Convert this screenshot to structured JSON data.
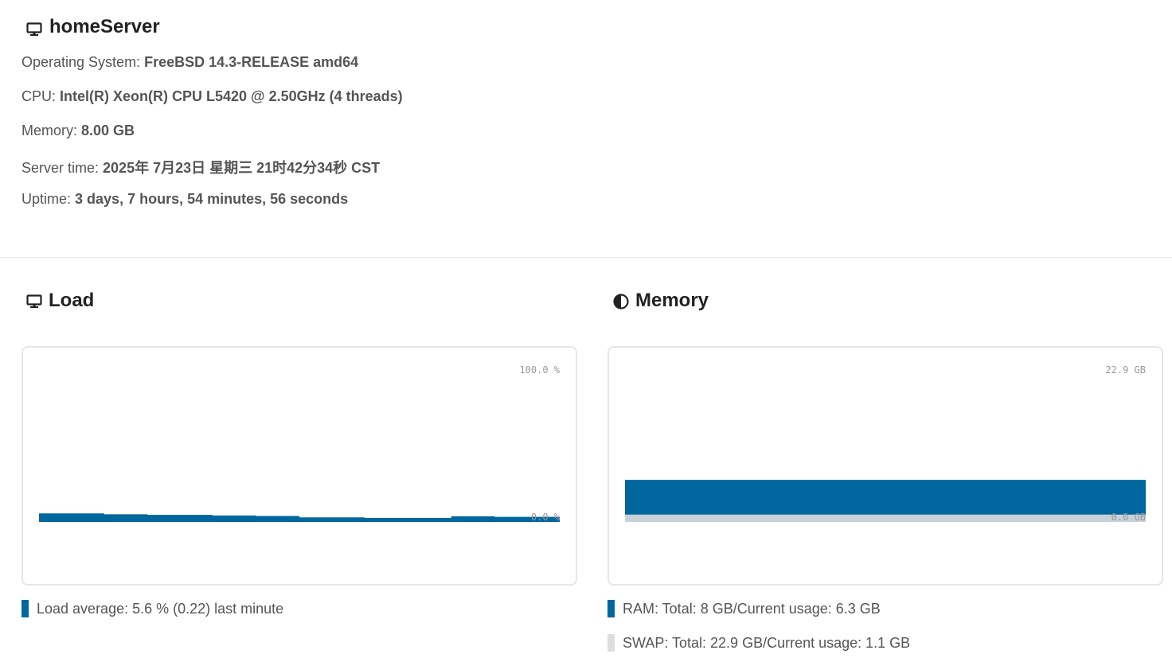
{
  "host": {
    "name": "homeServer",
    "icon": "monitor-icon"
  },
  "info": {
    "os_label": "Operating System: ",
    "os_value": "FreeBSD 14.3-RELEASE amd64",
    "cpu_label": "CPU: ",
    "cpu_value": "Intel(R) Xeon(R) CPU L5420 @ 2.50GHz (4 threads)",
    "memory_label": "Memory: ",
    "memory_value": "8.00 GB",
    "time_label": "Server time: ",
    "time_value": "2025年 7月23日 星期三 21时42分34秒 CST",
    "uptime_label": "Uptime: ",
    "uptime_value": "3 days, 7 hours, 54 minutes, 56 seconds"
  },
  "load": {
    "title": "Load",
    "icon": "monitor-icon",
    "legend": "Load average: 5.6 % (0.22) last minute",
    "color": "#00669e"
  },
  "memory": {
    "title": "Memory",
    "icon": "half-circle-icon",
    "legend_ram": "RAM: Total: 8 GB/Current usage: 6.3 GB",
    "legend_swap": "SWAP: Total: 22.9 GB/Current usage: 1.1 GB",
    "color_ram": "#00669e",
    "color_swap": "#dddddd"
  },
  "chart_data": [
    {
      "type": "area",
      "ylim": [
        0,
        100
      ],
      "y_unit": "%",
      "tick_labels": [
        "100.0 %",
        "0.0 %"
      ],
      "series": [
        {
          "values": [
            5.6,
            5.6,
            5.6,
            5.0,
            5.0,
            4.6,
            4.6,
            4.6,
            4.2,
            4.2,
            3.9,
            3.9,
            3.0,
            3.0,
            3.0,
            2.6,
            2.6,
            2.6,
            2.6,
            3.7,
            3.7,
            3.3,
            3.3,
            3.3
          ]
        }
      ]
    },
    {
      "type": "area",
      "ylim": [
        0,
        22.9
      ],
      "y_unit": "GB",
      "tick_labels": [
        "22.9 GB",
        "0.0 GB"
      ],
      "series": [
        {
          "values": [
            6.3,
            6.3,
            6.3,
            6.3,
            6.3,
            6.3,
            6.3,
            6.3,
            6.3,
            6.3
          ]
        },
        {
          "values": [
            1.1,
            1.1,
            1.1,
            1.1,
            1.1,
            1.1,
            1.1,
            1.1,
            1.1,
            1.1
          ]
        }
      ]
    }
  ]
}
